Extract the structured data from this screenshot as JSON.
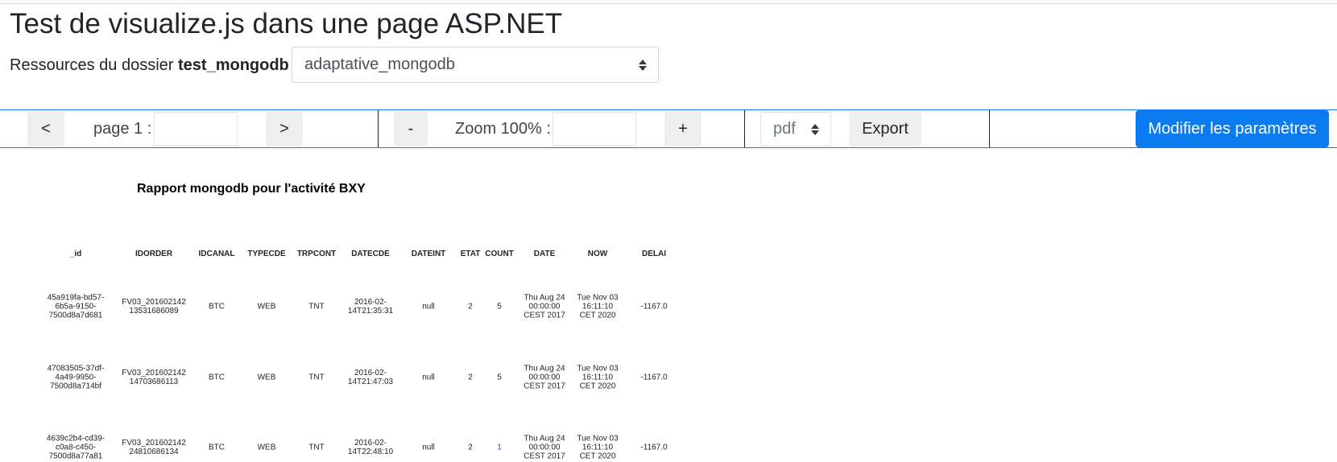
{
  "page": {
    "title": "Test de visualize.js dans une page ASP.NET"
  },
  "resources": {
    "label_prefix": "Ressources du dossier",
    "folder": "test_mongodb",
    "label_suffix": ":",
    "selected": "adaptative_mongodb"
  },
  "toolbar": {
    "prev_label": "<",
    "page_label": "page 1 :",
    "page_input_value": "",
    "next_label": ">",
    "zoom_out_label": "-",
    "zoom_label": "Zoom 100% :",
    "zoom_input_value": "",
    "zoom_in_label": "+",
    "format_selected": "pdf",
    "export_label": "Export",
    "modify_label": "Modifier les paramètres"
  },
  "report": {
    "title": "Rapport mongodb pour l'activité BXY",
    "columns": [
      "_id",
      "IDORDER",
      "IDCANAL",
      "TYPECDE",
      "TRPCONT",
      "DATECDE",
      "DATEINT",
      "ETAT",
      "COUNT",
      "DATE",
      "NOW",
      "DELAI"
    ],
    "rows": [
      [
        "45a919fa-bd57-\n6b5a-9150-\n7500d8a7d681",
        "FV03_201602142\n13531686089",
        "BTC",
        "WEB",
        "TNT",
        "2016-02-\n14T21:35:31",
        "null",
        "2",
        "5",
        "Thu Aug 24\n00:00:00\nCEST 2017",
        "Tue Nov 03\n16:11:10\nCET 2020",
        "-1167.0"
      ],
      [
        "47083505-37df-\n4a49-9950-\n7500d8a714bf",
        "FV03_201602142\n14703686113",
        "BTC",
        "WEB",
        "TNT",
        "2016-02-\n14T21:47:03",
        "null",
        "2",
        "5",
        "Thu Aug 24\n00:00:00\nCEST 2017",
        "Tue Nov 03\n16:11:10\nCET 2020",
        "-1167.0"
      ],
      [
        "4639c2b4-cd39-\nc0a8-c450-\n7500d8a77a81",
        "FV03_201602142\n24810686134",
        "BTC",
        "WEB",
        "TNT",
        "2016-02-\n14T22:48:10",
        "null",
        "2",
        "1",
        "Thu Aug 24\n00:00:00\nCEST 2017",
        "Tue Nov 03\n16:11:10\nCET 2020",
        "-1167.0"
      ]
    ]
  }
}
